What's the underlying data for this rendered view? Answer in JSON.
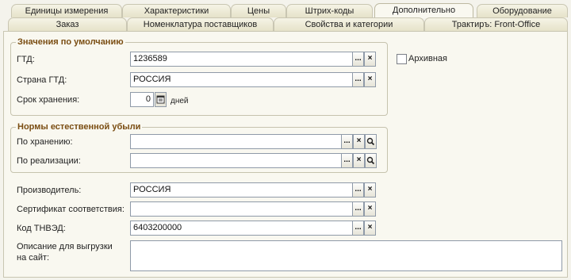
{
  "tabs_row1": [
    "Единицы измерения",
    "Характеристики",
    "Цены",
    "Штрих-коды",
    "Дополнительно",
    "Оборудование"
  ],
  "tabs_row2": [
    "Заказ",
    "Номенклатура поставщиков",
    "Свойства и категории",
    "Трактиръ: Front-Office"
  ],
  "active_tab": "Дополнительно",
  "defaults_group": {
    "title": "Значения по умолчанию",
    "gtd_label": "ГТД:",
    "gtd_value": "1236589",
    "country_label": "Страна ГТД:",
    "country_value": "РОССИЯ",
    "shelf_label": "Срок хранения:",
    "shelf_value": "0",
    "shelf_unit": "дней"
  },
  "archive": {
    "label": "Архивная",
    "checked": false
  },
  "loss_group": {
    "title": "Нормы естественной убыли",
    "storage_label": "По хранению:",
    "storage_value": "",
    "sale_label": "По реализации:",
    "sale_value": ""
  },
  "producer_label": "Производитель:",
  "producer_value": "РОССИЯ",
  "certificate_label": "Сертификат соответствия:",
  "certificate_value": "",
  "tnved_label": "Код ТНВЭД:",
  "tnved_value": "6403200000",
  "description_label": "Описание для выгрузки на сайт:",
  "description_value": "",
  "buttons": {
    "select": "...",
    "clear": "×"
  }
}
